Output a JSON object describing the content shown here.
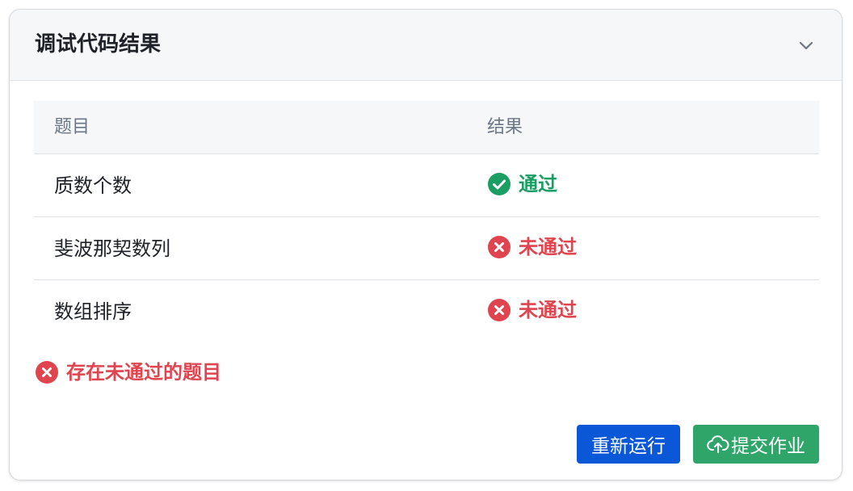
{
  "card": {
    "title": "调试代码结果",
    "collapse_icon": "chevron-down-icon"
  },
  "table": {
    "headers": [
      "题目",
      "结果"
    ],
    "rows": [
      {
        "name": "质数个数",
        "result": "通过",
        "status": "pass",
        "icon": "check-circle-icon"
      },
      {
        "name": "斐波那契数列",
        "result": "未通过",
        "status": "fail",
        "icon": "x-circle-icon"
      },
      {
        "name": "数组排序",
        "result": "未通过",
        "status": "fail",
        "icon": "x-circle-icon"
      }
    ]
  },
  "summary": {
    "text": "存在未通过的题目",
    "icon": "x-circle-icon"
  },
  "actions": {
    "rerun_label": "重新运行",
    "submit_label": "提交作业",
    "submit_icon": "cloud-upload-icon"
  },
  "colors": {
    "pass": "#1a9e64",
    "fail": "#e0454f",
    "primary": "#0a58d8",
    "success_button": "#2fa56a"
  }
}
